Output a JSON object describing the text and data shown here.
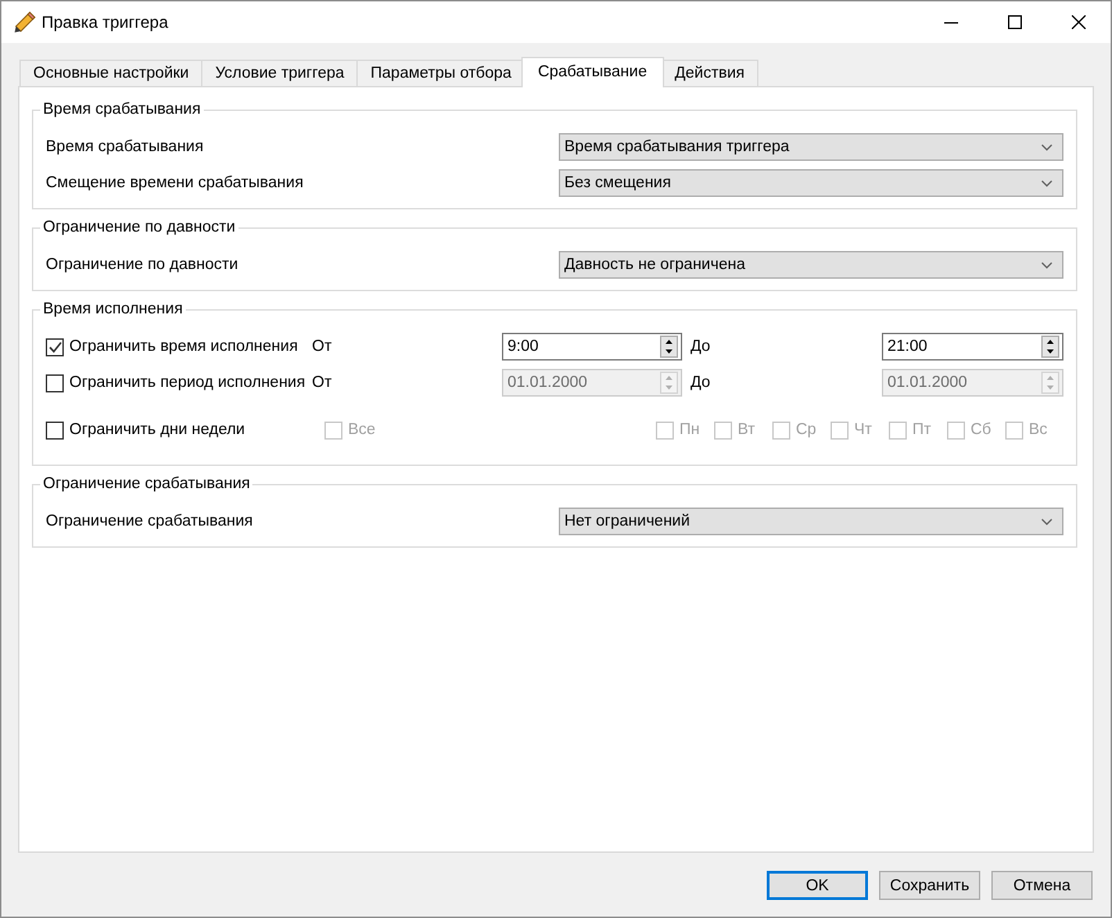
{
  "window": {
    "title": "Правка триггера"
  },
  "tabs": [
    {
      "label": "Основные настройки",
      "selected": false
    },
    {
      "label": "Условие триггера",
      "selected": false
    },
    {
      "label": "Параметры отбора",
      "selected": false
    },
    {
      "label": "Срабатывание",
      "selected": true
    },
    {
      "label": "Действия",
      "selected": false
    }
  ],
  "groups": [
    {
      "title": "Время срабатывания",
      "rows": [
        {
          "kind": "dropdown",
          "label": "Время срабатывания",
          "value": "Время срабатывания триггера"
        },
        {
          "kind": "dropdown",
          "label": "Смещение времени срабатывания",
          "value": "Без смещения"
        }
      ]
    },
    {
      "title": "Ограничение по давности",
      "rows": [
        {
          "kind": "dropdown",
          "label": "Ограничение по давности",
          "value": "Давность не ограничена"
        }
      ]
    },
    {
      "title": "Время исполнения",
      "rows": [
        {
          "kind": "range",
          "label": "Ограничить время исполнения",
          "checked": true,
          "from_label": "От",
          "from": {
            "value": "9:00",
            "disabled": false
          },
          "to_label": "До",
          "to": {
            "value": "21:00",
            "disabled": false
          }
        },
        {
          "kind": "range",
          "label": "Ограничить период исполнения",
          "checked": false,
          "from_label": "От",
          "from": {
            "value": "01.01.2000",
            "disabled": true
          },
          "to_label": "До",
          "to": {
            "value": "01.01.2000",
            "disabled": true
          }
        },
        {
          "kind": "weekdays",
          "label": "Ограничить дни недели",
          "checked": false,
          "options": [
            {
              "label": "Все",
              "checked": false,
              "disabled": true
            }
          ],
          "days": [
            {
              "label": "Пн",
              "checked": false,
              "disabled": true
            },
            {
              "label": "Вт",
              "checked": false,
              "disabled": true
            },
            {
              "label": "Ср",
              "checked": false,
              "disabled": true
            },
            {
              "label": "Чт",
              "checked": false,
              "disabled": true
            },
            {
              "label": "Пт",
              "checked": false,
              "disabled": true
            },
            {
              "label": "Сб",
              "checked": false,
              "disabled": true
            },
            {
              "label": "Вс",
              "checked": false,
              "disabled": true
            }
          ]
        }
      ]
    },
    {
      "title": "Ограничение срабатывания",
      "rows": [
        {
          "kind": "dropdown",
          "label": "Ограничение срабатывания",
          "value": "Нет ограничений"
        }
      ]
    }
  ],
  "buttons": [
    {
      "label": "OK",
      "focused": true
    },
    {
      "label": "Сохранить",
      "focused": false
    },
    {
      "label": "Отмена",
      "focused": false
    }
  ]
}
